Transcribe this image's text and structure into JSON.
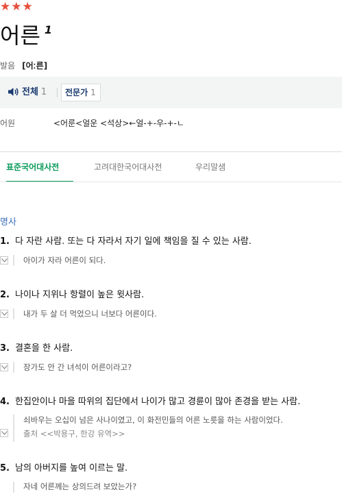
{
  "entry": {
    "stars": "★★★",
    "headword": "어른",
    "homonym_number": "1"
  },
  "pronunciation": {
    "label": "발음",
    "value": "[어ː른]"
  },
  "audio": {
    "all_label": "전체",
    "all_count": "1",
    "expert_label": "전문가",
    "expert_count": "1"
  },
  "etymology": {
    "label": "어원",
    "value": "<어룬<얼운 <석상>←얼-+-우-+-ㄴ"
  },
  "tabs": [
    {
      "label": "표준국어대사전",
      "active": true
    },
    {
      "label": "고려대한국어대사전",
      "active": false
    },
    {
      "label": "우리말샘",
      "active": false
    }
  ],
  "part_of_speech": "명사",
  "senses": [
    {
      "number": "1.",
      "definition": "다 자란 사람. 또는 다 자라서 자기 일에 책임을 질 수 있는 사람.",
      "examples": [
        "아이가 자라 어른이 되다."
      ],
      "source": ""
    },
    {
      "number": "2.",
      "definition": "나이나 지위나 항렬이 높은 윗사람.",
      "examples": [
        "내가 두 살 더 먹었으니 너보다 어른이다."
      ],
      "source": ""
    },
    {
      "number": "3.",
      "definition": "결혼을 한 사람.",
      "examples": [
        "장가도 안 간 녀석이 어른이라고?"
      ],
      "source": ""
    },
    {
      "number": "4.",
      "definition": "한집안이나 마을 따위의 집단에서 나이가 많고 경륜이 많아 존경을 받는 사람.",
      "examples": [
        "쇠바우는 오십이 넘은 사나이였고, 이 화전민들의 어른 노릇을 하는 사람이었다."
      ],
      "source": "출처 <<박용구, 한강 유역>>"
    },
    {
      "number": "5.",
      "definition": "남의 아버지를 높여 이르는 말.",
      "examples": [
        "자네 어른께는 상의드려 보았는가?"
      ],
      "source": ""
    }
  ],
  "colors": {
    "star": "#e84e3a",
    "active_tab": "#0b9b5a",
    "part_of_speech": "#3b6fb6",
    "audio_text": "#1a3a6e"
  }
}
